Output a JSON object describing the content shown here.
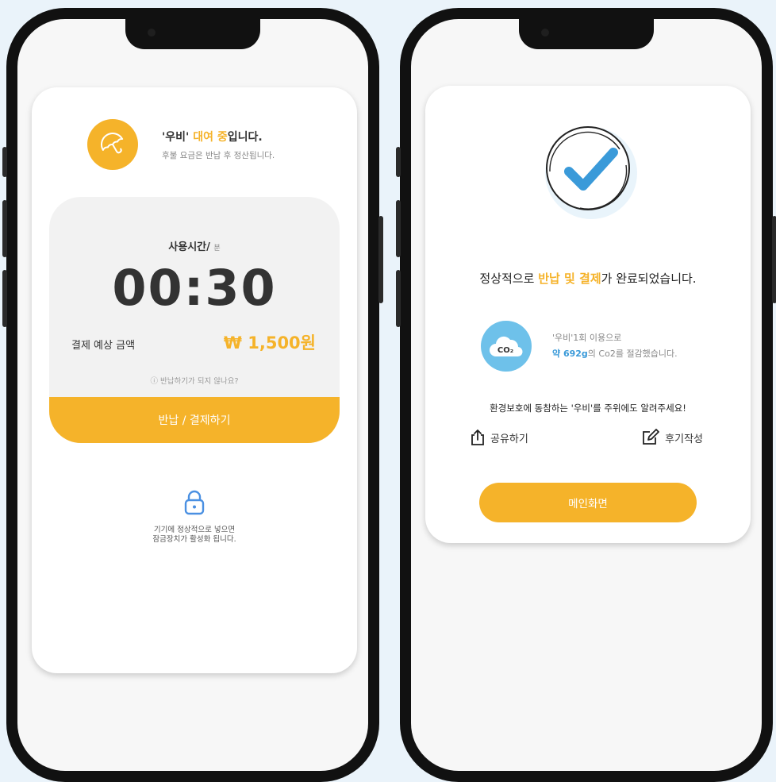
{
  "rental_screen": {
    "title_prefix": "'우비'",
    "title_highlight": "대여 중",
    "title_suffix": "입니다.",
    "subtitle": "후불 요금은 반납 후 정산됩니다.",
    "usage_label": "사용시간/",
    "usage_unit": "분",
    "timer": "00:30",
    "estimate_label": "결제 예상 금액",
    "estimate_amount": "₩ 1,500원",
    "help_link": "ⓘ 반납하기가 되지 않나요?",
    "return_button": "반납 / 결제하기",
    "lock_note": "기기에 정상적으로 넣으면\n잠금장치가 활성화 됩니다."
  },
  "complete_screen": {
    "message_prefix": "정상적으로 ",
    "message_highlight": "반납 및 결제",
    "message_suffix": "가 완료되었습니다.",
    "co2_badge": "CO₂",
    "co2_line1": "'우비'1회 이용으로",
    "co2_amount": "약 692g",
    "co2_line2_suffix": "의 Co2를 절감했습니다.",
    "share_message": "환경보호에 동참하는 '우비'를 주위에도 알려주세요!",
    "share_label": "공유하기",
    "review_label": "후기작성",
    "main_button": "메인화면"
  },
  "colors": {
    "accent": "#f5b32a",
    "co2_blue": "#6ec1ea",
    "check_blue": "#3a9ad9"
  },
  "icons": {
    "umbrella": "umbrella-icon",
    "lock": "lock-icon",
    "check": "check-icon",
    "co2": "co2-cloud-icon",
    "share": "share-icon",
    "edit": "edit-icon"
  }
}
